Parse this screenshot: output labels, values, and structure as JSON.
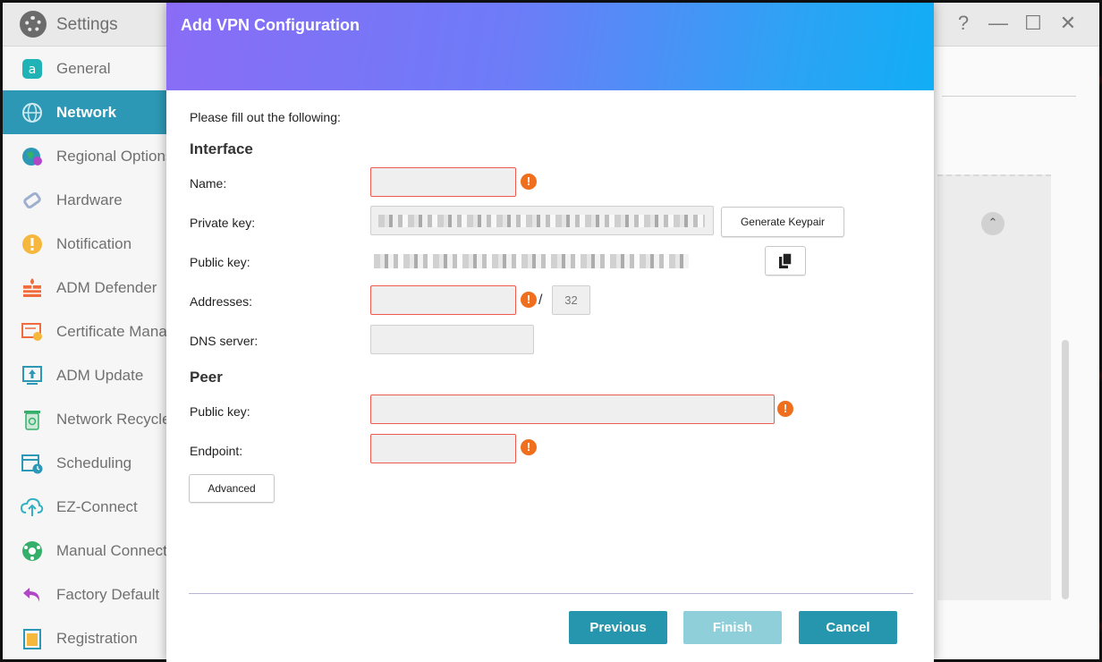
{
  "window": {
    "title": "Settings"
  },
  "title_controls": {
    "help": "?",
    "minimize": "—",
    "maximize": "☐",
    "close": "✕"
  },
  "sidebar": {
    "items": [
      {
        "label": "General",
        "icon": "general-icon",
        "color": "#1fb3b5"
      },
      {
        "label": "Network",
        "icon": "globe-icon",
        "color": "#ffffff",
        "active": true
      },
      {
        "label": "Regional Options",
        "icon": "region-globe-icon",
        "color": "#2d98b5"
      },
      {
        "label": "Hardware",
        "icon": "hardware-icon",
        "color": "#8aa0c8"
      },
      {
        "label": "Notification",
        "icon": "alert-icon",
        "color": "#f5b83d"
      },
      {
        "label": "ADM Defender",
        "icon": "firewall-icon",
        "color": "#ef6d3c"
      },
      {
        "label": "Certificate Manager",
        "icon": "certificate-icon",
        "color": "#ef6d3c"
      },
      {
        "label": "ADM Update",
        "icon": "update-icon",
        "color": "#2d98b5"
      },
      {
        "label": "Network Recycle Bin",
        "icon": "recycle-icon",
        "color": "#35b06b"
      },
      {
        "label": "Scheduling",
        "icon": "calendar-icon",
        "color": "#2d98b5"
      },
      {
        "label": "EZ-Connect",
        "icon": "cloud-upload-icon",
        "color": "#35b0c0"
      },
      {
        "label": "Manual Connect",
        "icon": "connect-icon",
        "color": "#35b06b"
      },
      {
        "label": "Factory Default",
        "icon": "undo-icon",
        "color": "#b047c7"
      },
      {
        "label": "Registration",
        "icon": "registration-icon",
        "color": "#2d98b5"
      }
    ]
  },
  "modal": {
    "title": "Add VPN Configuration",
    "intro": "Please fill out the following:",
    "interface_heading": "Interface",
    "peer_heading": "Peer",
    "fields": {
      "name": {
        "label": "Name:",
        "value": ""
      },
      "private_key": {
        "label": "Private key:"
      },
      "public_key": {
        "label": "Public key:"
      },
      "addresses": {
        "label": "Addresses:",
        "value": "",
        "separator": "/",
        "prefix": "32"
      },
      "dns": {
        "label": "DNS server:",
        "value": ""
      },
      "peer_public_key": {
        "label": "Public key:",
        "value": ""
      },
      "endpoint": {
        "label": "Endpoint:",
        "value": ""
      }
    },
    "generate_keypair": "Generate Keypair",
    "advanced": "Advanced",
    "warning_symbol": "!",
    "buttons": {
      "previous": "Previous",
      "finish": "Finish",
      "cancel": "Cancel"
    },
    "colors": {
      "primary_button": "#2596ad",
      "disabled_button": "#8fcfda",
      "error": "#f05a4c",
      "warning": "#ef6f1e"
    }
  }
}
